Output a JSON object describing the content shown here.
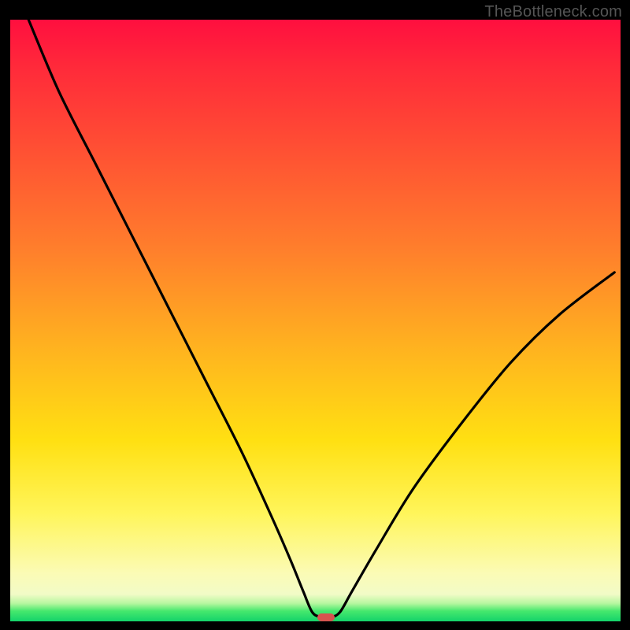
{
  "watermark": "TheBottleneck.com",
  "colors": {
    "curve_stroke": "#000000",
    "marker_fill": "#d6544f"
  },
  "chart_data": {
    "type": "line",
    "title": "",
    "xlabel": "",
    "ylabel": "",
    "xlim": [
      0,
      100
    ],
    "ylim": [
      0,
      100
    ],
    "grid": false,
    "legend": false,
    "series": [
      {
        "name": "bottleneck-curve",
        "x": [
          3,
          8,
          14,
          20,
          26,
          32,
          38,
          43,
          46,
          48,
          49.5,
          51,
          52.5,
          54,
          56,
          60,
          66,
          74,
          82,
          90,
          99
        ],
        "values": [
          100,
          88,
          76,
          64,
          52,
          40,
          28,
          17,
          10,
          5,
          1.5,
          0.7,
          0.7,
          1.5,
          5,
          12,
          22,
          33,
          43,
          51,
          58
        ]
      }
    ],
    "annotations": [
      {
        "name": "optimal-marker",
        "x": 51.8,
        "y": 0.7
      }
    ],
    "note": "No numeric axis ticks or labels are visible; values inferred from curve geometry on a 0–100 normalized scale."
  }
}
